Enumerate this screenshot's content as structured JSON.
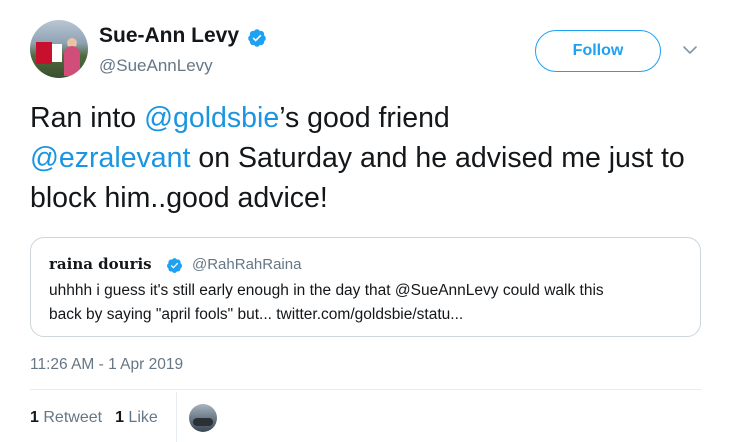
{
  "author": {
    "display_name": "Sue-Ann Levy",
    "handle": "@SueAnnLevy",
    "verified": true
  },
  "follow_button": {
    "label": "Follow"
  },
  "tweet": {
    "segments": [
      {
        "text": "Ran into ",
        "type": "text"
      },
      {
        "text": "@goldsbie",
        "type": "mention"
      },
      {
        "text": "’s good friend ",
        "type": "text"
      },
      {
        "text": "@ezralevant",
        "type": "mention"
      },
      {
        "text": " on Saturday and he advised me just to block him..good advice!",
        "type": "text"
      }
    ]
  },
  "quoted_tweet": {
    "display_name": "raina douris",
    "handle": "@RahRahRaina",
    "verified": true,
    "text_line1": "uhhhh i guess it's still early enough in the day that @SueAnnLevy could walk this",
    "text_line2": "back by saying \"april fools\" but... twitter.com/goldsbie/statu..."
  },
  "timestamp": "11:26 AM - 1 Apr 2019",
  "stats": {
    "retweets_count": "1",
    "retweets_label": "Retweet",
    "likes_count": "1",
    "likes_label": "Like"
  },
  "colors": {
    "accent": "#1da1f2",
    "mention": "#1b95e0",
    "secondary_text": "#657786",
    "border": "#ccd6dd"
  },
  "icons": {
    "verified": "verified-badge-icon",
    "caret": "chevron-down-icon"
  }
}
